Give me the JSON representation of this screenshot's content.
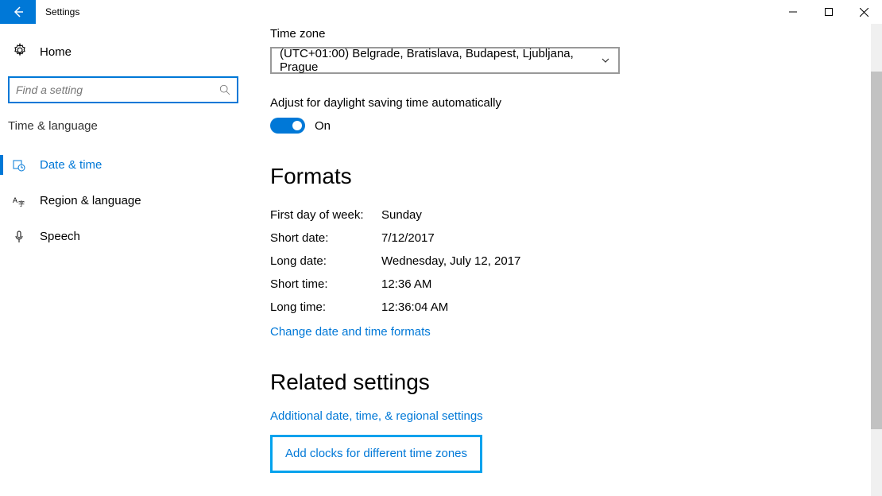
{
  "window": {
    "title": "Settings"
  },
  "sidebar": {
    "home": "Home",
    "search_placeholder": "Find a setting",
    "category": "Time & language",
    "items": [
      {
        "label": "Date & time"
      },
      {
        "label": "Region & language"
      },
      {
        "label": "Speech"
      }
    ]
  },
  "main": {
    "timezone_label": "Time zone",
    "timezone_value": "(UTC+01:00) Belgrade, Bratislava, Budapest, Ljubljana, Prague",
    "dst_label": "Adjust for daylight saving time automatically",
    "dst_toggle_text": "On",
    "formats_heading": "Formats",
    "formats": [
      {
        "k": "First day of week:",
        "v": "Sunday"
      },
      {
        "k": "Short date:",
        "v": "7/12/2017"
      },
      {
        "k": "Long date:",
        "v": "Wednesday, July 12, 2017"
      },
      {
        "k": "Short time:",
        "v": "12:36 AM"
      },
      {
        "k": "Long time:",
        "v": "12:36:04 AM"
      }
    ],
    "change_formats_link": "Change date and time formats",
    "related_heading": "Related settings",
    "related_link_1": "Additional date, time, & regional settings",
    "related_link_2": "Add clocks for different time zones"
  }
}
